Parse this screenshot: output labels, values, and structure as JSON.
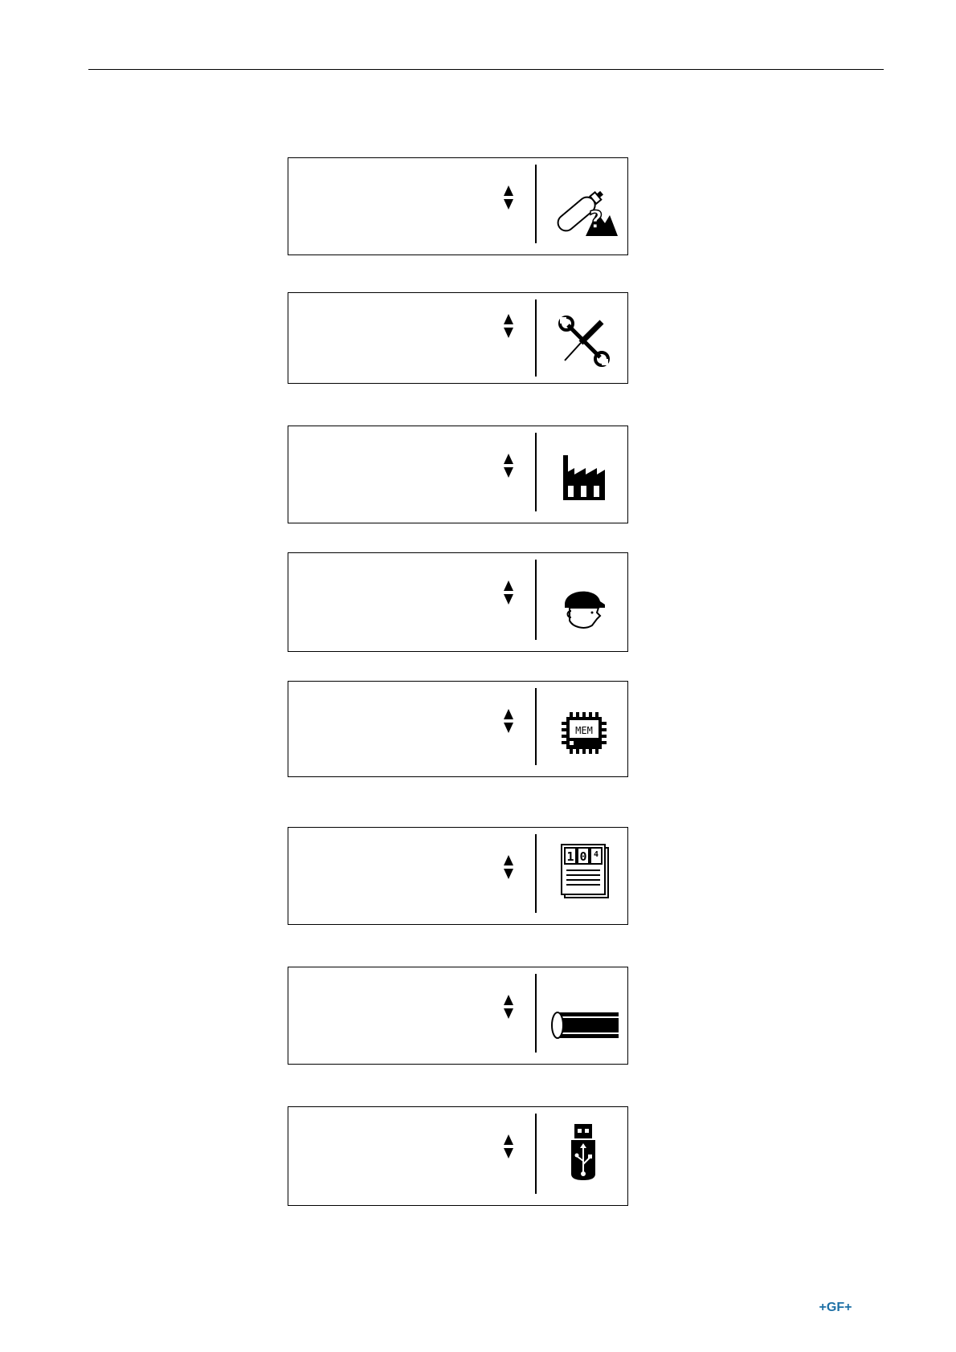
{
  "footer": {
    "logo_text": "+GF+"
  },
  "screens": [
    {
      "icon": "welding-help-icon"
    },
    {
      "icon": "tools-icon"
    },
    {
      "icon": "factory-icon"
    },
    {
      "icon": "operator-icon"
    },
    {
      "icon": "memory-chip-icon"
    },
    {
      "icon": "counter-report-icon"
    },
    {
      "icon": "pipe-icon"
    },
    {
      "icon": "usb-stick-icon"
    }
  ],
  "colors": {
    "logo": "#1c6fa5",
    "lcd_ink": "#000000"
  }
}
